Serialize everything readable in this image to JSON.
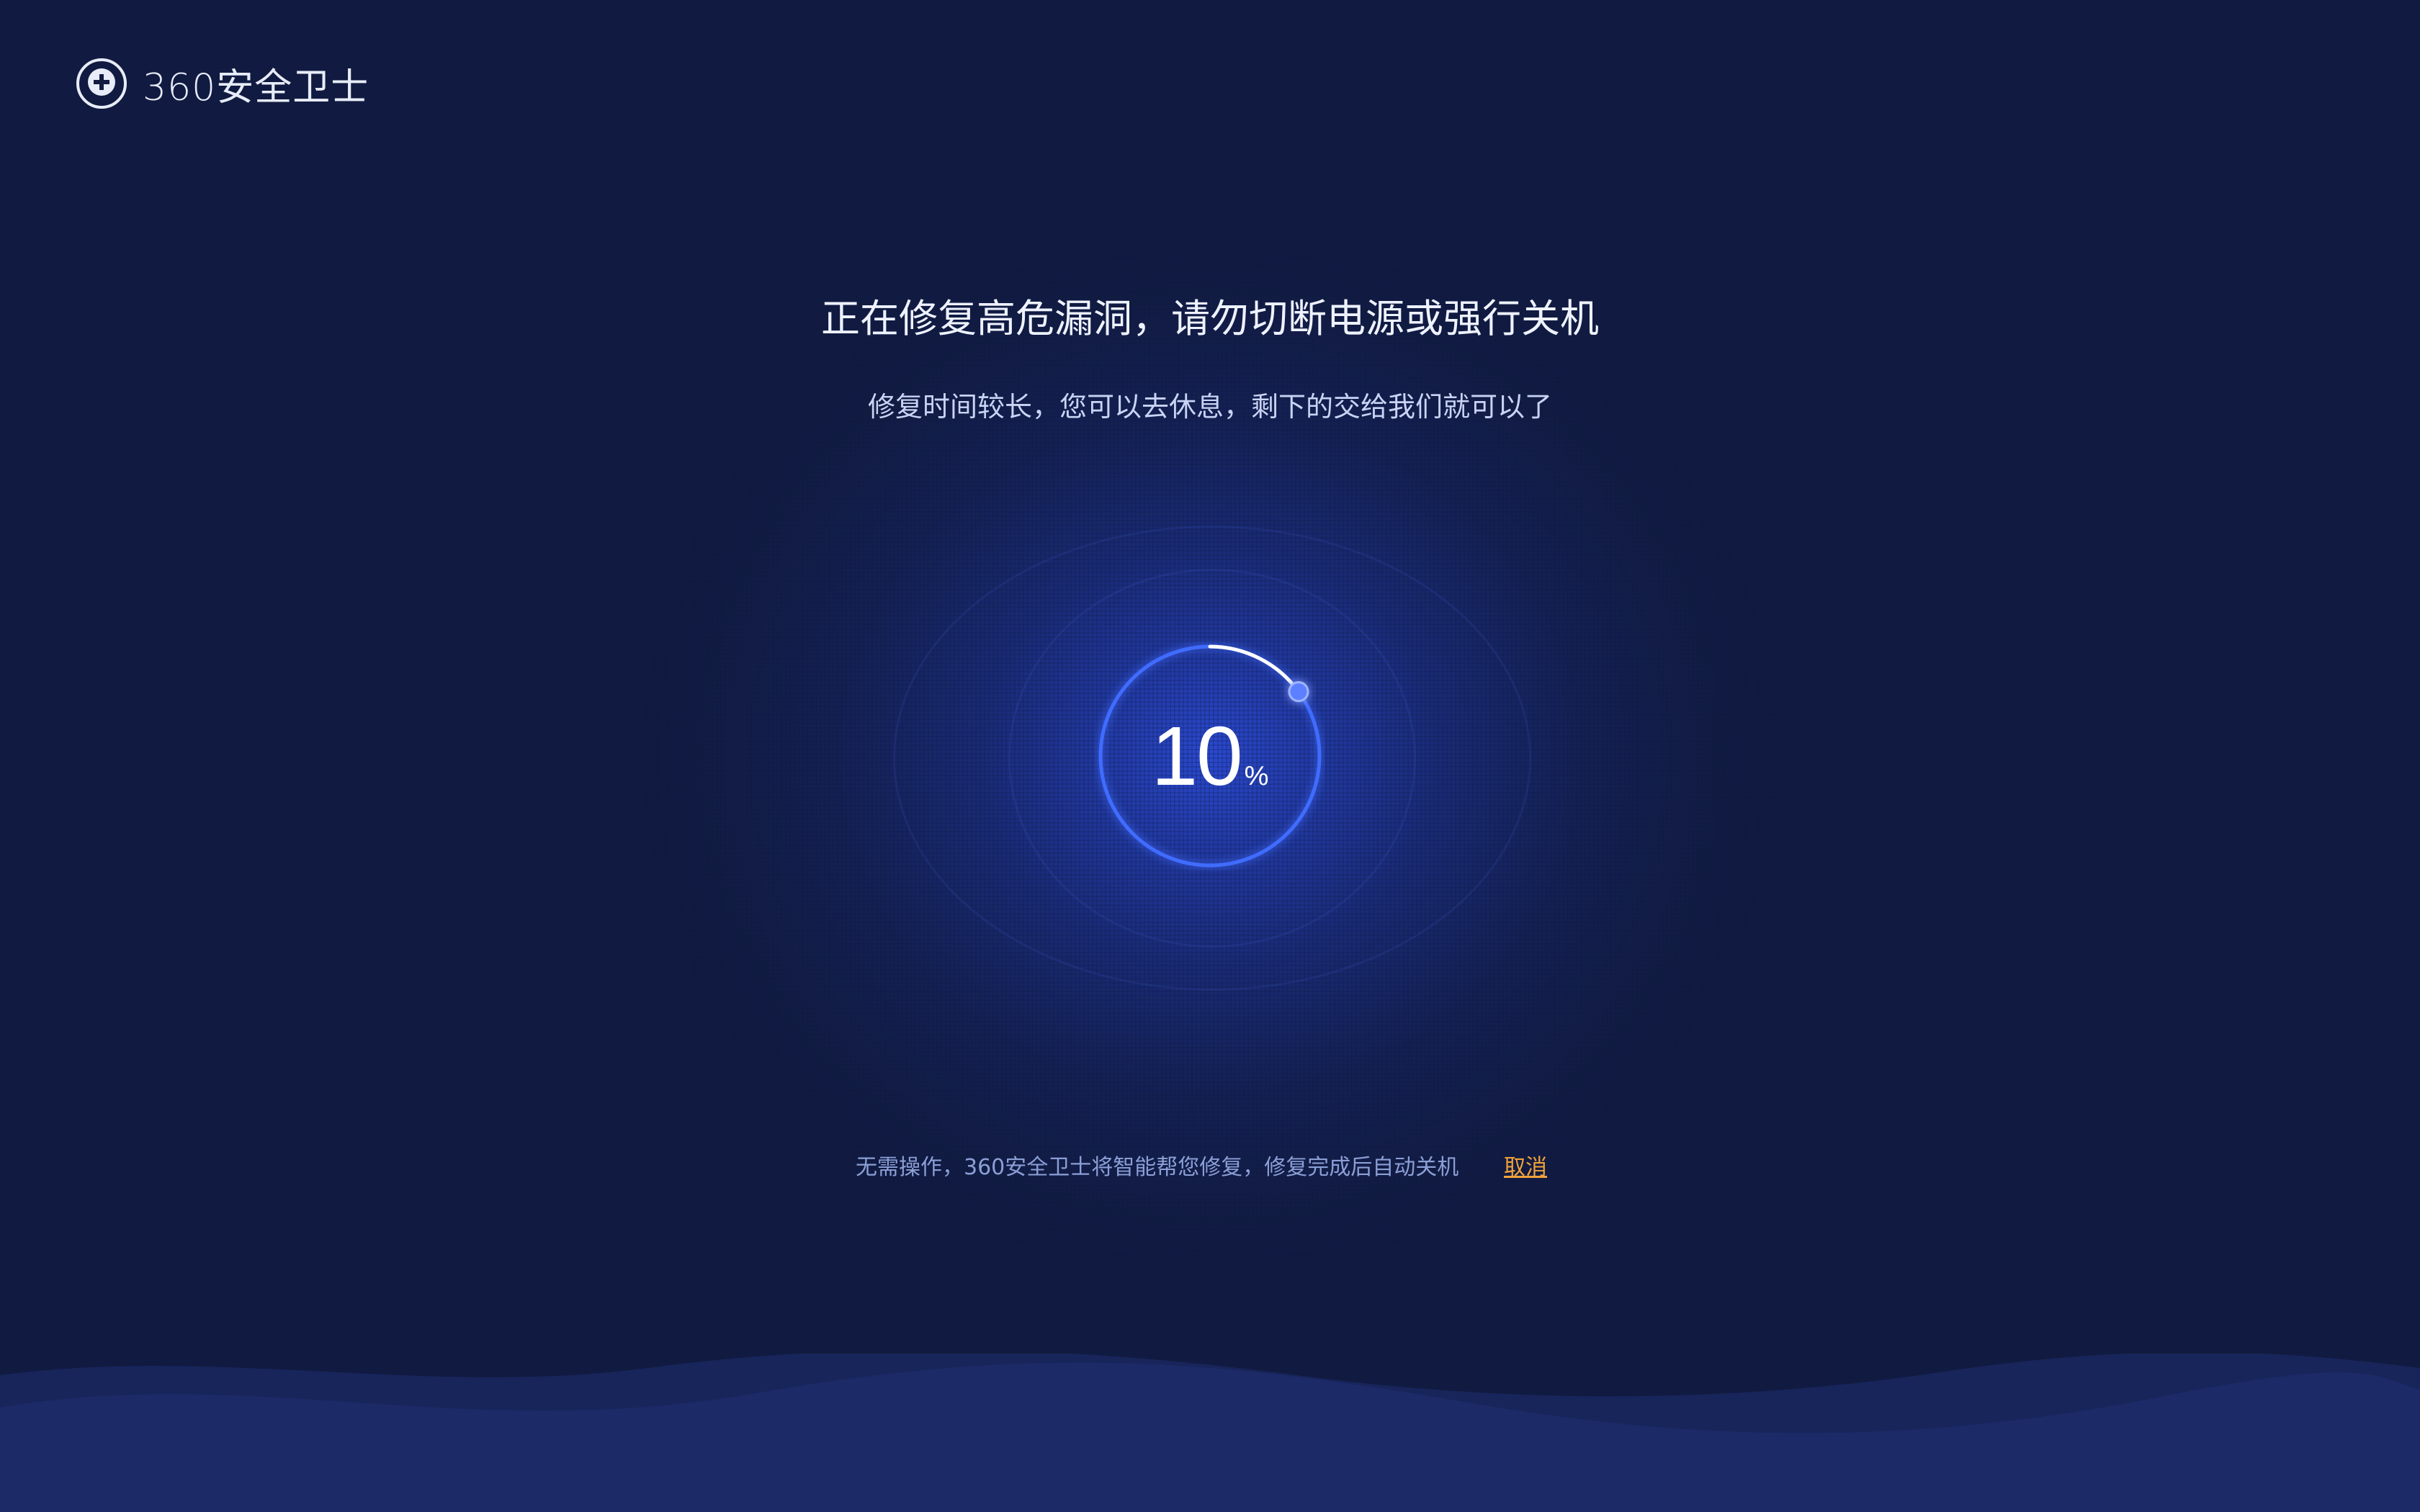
{
  "app": {
    "logo_text": "360安全卫士",
    "logo_icon": "shield-plus-icon"
  },
  "main": {
    "headline": "正在修复高危漏洞，请勿切断电源或强行关机",
    "subline": "修复时间较长，您可以去休息，剩下的交给我们就可以了",
    "progress": {
      "value": "10",
      "unit": "%",
      "fraction": 0.1
    },
    "footer_note": "无需操作，360安全卫士将智能帮您修复，修复完成后自动关机",
    "cancel_label": "取消"
  },
  "colors": {
    "background": "#111b41",
    "accent_blue": "#3f6cff",
    "cancel_orange": "#f0a23a",
    "text_primary": "#eef2ff",
    "text_secondary": "#c9d3f4",
    "text_muted": "#8b9fd6"
  }
}
